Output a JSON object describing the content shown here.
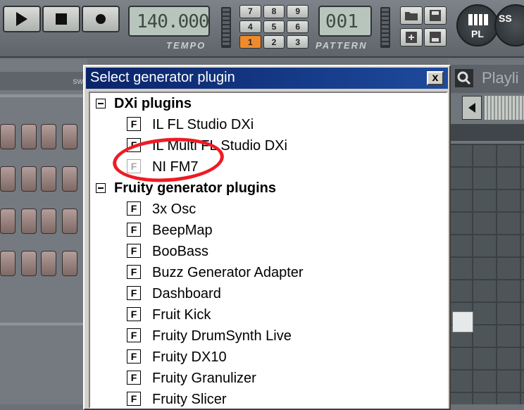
{
  "toolbar": {
    "tempo_value": "140.000",
    "tempo_label": "TEMPO",
    "pattern_value": "001",
    "pattern_label": "PATTERN",
    "numpad": [
      "7",
      "8",
      "9",
      "4",
      "5",
      "6",
      "1",
      "2",
      "3"
    ],
    "numpad_active": "1",
    "playlist_button_label": "PL",
    "step_seq_button_label": "SS"
  },
  "left_panel": {
    "header_label": "sw"
  },
  "right_panel": {
    "title": "Playli"
  },
  "dialog": {
    "title": "Select generator plugin",
    "close_label": "x",
    "groups": [
      {
        "label": "DXi plugins",
        "items": [
          "IL FL Studio DXi",
          "IL Multi FL Studio DXi",
          "NI FM7"
        ]
      },
      {
        "label": "Fruity generator plugins",
        "items": [
          "3x Osc",
          "BeepMap",
          "BooBass",
          "Buzz Generator Adapter",
          "Dashboard",
          "Fruit Kick",
          "Fruity DrumSynth Live",
          "Fruity DX10",
          "Fruity Granulizer",
          "Fruity Slicer"
        ]
      }
    ],
    "plugin_icon_letter": "F",
    "highlighted_item": "NI FM7",
    "highlight_color": "#ee1b24"
  }
}
